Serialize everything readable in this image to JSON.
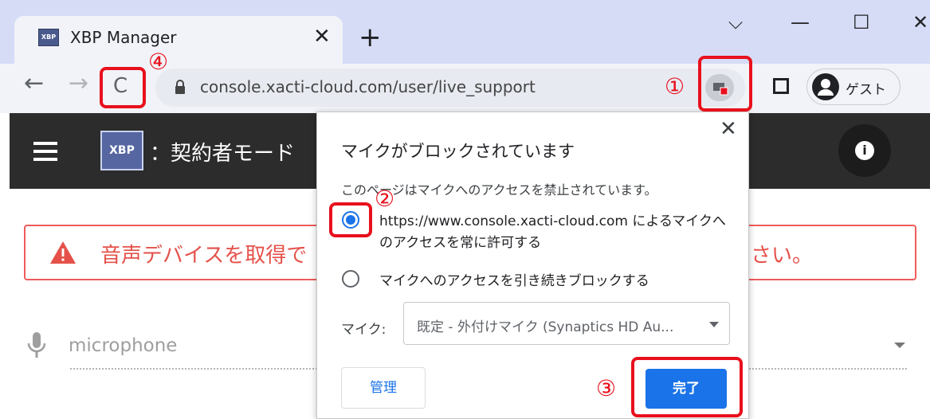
{
  "browser": {
    "tab": {
      "favicon_text": "XBP",
      "title": "XBP Manager",
      "close": "✕"
    },
    "new_tab": "+",
    "window_controls": {
      "menu": "⌵",
      "minimize": "—",
      "maximize": "☐",
      "close": "✕"
    },
    "nav": {
      "back": "←",
      "forward": "→",
      "reload": "C"
    },
    "url": "console.xacti-cloud.com/user/live_support",
    "profile_label": "ゲスト",
    "menu": "⋮"
  },
  "app": {
    "logo_text": "XBP",
    "title": "：契約者モード",
    "info_label": "i"
  },
  "alert": {
    "text": "音声デバイスを取得で",
    "tail": "さい。"
  },
  "microphone_field": {
    "label": "microphone"
  },
  "permission_bubble": {
    "close": "✕",
    "title": "マイクがブロックされています",
    "description": "このページはマイクへのアクセスを禁止されています。",
    "options": [
      {
        "label": "https://www.console.xacti-cloud.com によるマイクへのアクセスを常に許可する",
        "selected": true
      },
      {
        "label": "マイクへのアクセスを引き続きブロックする",
        "selected": false
      }
    ],
    "mic_label": "マイク:",
    "mic_value": "既定 - 外付けマイク (Synaptics HD Au...",
    "manage_button": "管理",
    "done_button": "完了"
  },
  "annotations": {
    "step1": "①",
    "step2": "②",
    "step3": "③",
    "step4": "④",
    "color": "#e8101c"
  }
}
